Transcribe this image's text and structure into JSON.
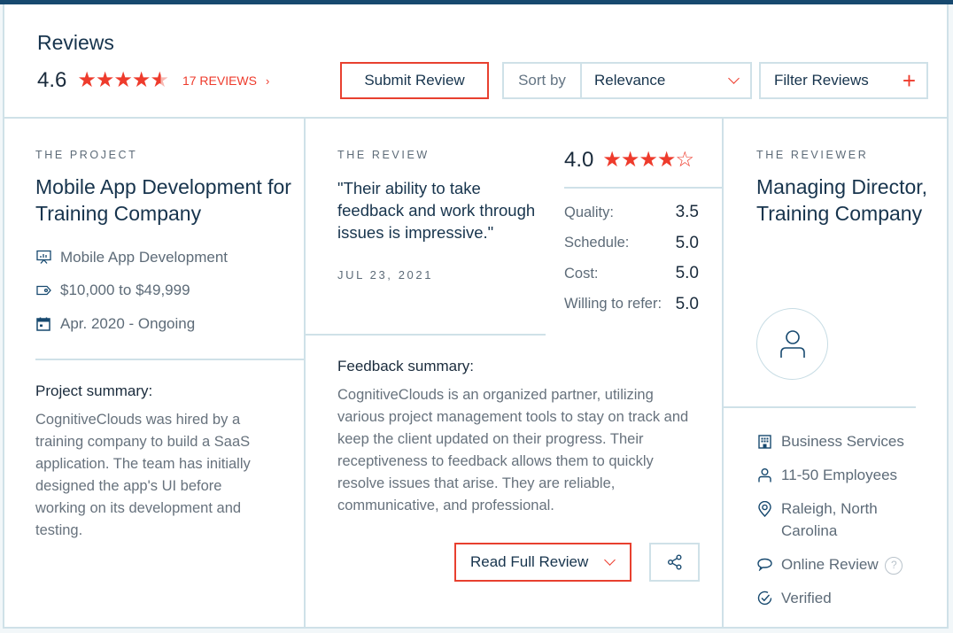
{
  "header": {
    "title": "Reviews",
    "rating": "4.6",
    "stars": {
      "full": 4,
      "partial": 0.6,
      "empty": 0
    },
    "reviews_count_label": "17 REVIEWS",
    "submit_label": "Submit Review",
    "sort_label": "Sort by",
    "sort_value": "Relevance",
    "filter_label": "Filter Reviews",
    "accent_color": "#ee3b2c",
    "brand_color": "#17496f"
  },
  "project": {
    "eyebrow": "THE PROJECT",
    "title": "Mobile App Development for Training Company",
    "meta": [
      {
        "icon": "presentation-chart-icon",
        "text": "Mobile App Development"
      },
      {
        "icon": "price-tag-icon",
        "text": "$10,000 to $49,999"
      },
      {
        "icon": "calendar-icon",
        "text": "Apr. 2020 - Ongoing"
      }
    ],
    "summary_heading": "Project summary:",
    "summary_text": "CognitiveClouds was hired by a training company to build a SaaS application. The team has initially designed the app's UI before working on its development and testing."
  },
  "review": {
    "eyebrow": "THE REVIEW",
    "quote": "\"Their ability to take feedback and work through issues is impressive.\"",
    "date": "JUL 23, 2021",
    "overall": "4.0",
    "overall_stars": {
      "full": 4,
      "empty": 1
    },
    "scores": [
      {
        "label": "Quality:",
        "value": "3.5"
      },
      {
        "label": "Schedule:",
        "value": "5.0"
      },
      {
        "label": "Cost:",
        "value": "5.0"
      },
      {
        "label": "Willing to refer:",
        "value": "5.0"
      }
    ],
    "feedback_heading": "Feedback summary:",
    "feedback_text": "CognitiveClouds is an organized partner, utilizing various project management tools to stay on track and keep the client updated on their progress. Their receptiveness to feedback allows them to quickly resolve issues that arise. They are reliable, communicative, and professional.",
    "read_full_label": "Read Full Review"
  },
  "reviewer": {
    "eyebrow": "THE REVIEWER",
    "title": "Managing Director, Training Company",
    "details": [
      {
        "icon": "building-icon",
        "text": "Business Services"
      },
      {
        "icon": "person-icon",
        "text": "11-50 Employees"
      },
      {
        "icon": "location-pin-icon",
        "text": "Raleigh, North Carolina"
      },
      {
        "icon": "speech-bubble-icon",
        "text": "Online Review",
        "help": "?"
      },
      {
        "icon": "check-circle-icon",
        "text": "Verified"
      }
    ]
  }
}
